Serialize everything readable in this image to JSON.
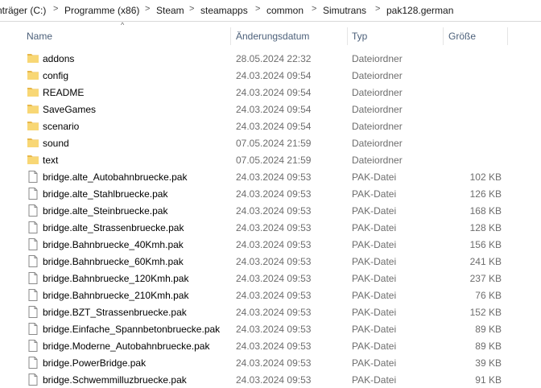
{
  "breadcrumb": {
    "items": [
      "nträger (C:)",
      "Programme (x86)",
      "Steam",
      "steamapps",
      "common",
      "Simutrans",
      "pak128.german"
    ],
    "separator": ">"
  },
  "columns": {
    "name": "Name",
    "date": "Änderungsdatum",
    "type": "Typ",
    "size": "Größe",
    "sort_indicator": "^"
  },
  "files": [
    {
      "kind": "folder",
      "name": "addons",
      "date": "28.05.2024 22:32",
      "type": "Dateiordner",
      "size": ""
    },
    {
      "kind": "folder",
      "name": "config",
      "date": "24.03.2024 09:54",
      "type": "Dateiordner",
      "size": ""
    },
    {
      "kind": "folder",
      "name": "README",
      "date": "24.03.2024 09:54",
      "type": "Dateiordner",
      "size": ""
    },
    {
      "kind": "folder",
      "name": "SaveGames",
      "date": "24.03.2024 09:54",
      "type": "Dateiordner",
      "size": ""
    },
    {
      "kind": "folder",
      "name": "scenario",
      "date": "24.03.2024 09:54",
      "type": "Dateiordner",
      "size": ""
    },
    {
      "kind": "folder",
      "name": "sound",
      "date": "07.05.2024 21:59",
      "type": "Dateiordner",
      "size": ""
    },
    {
      "kind": "folder",
      "name": "text",
      "date": "07.05.2024 21:59",
      "type": "Dateiordner",
      "size": ""
    },
    {
      "kind": "file",
      "name": "bridge.alte_Autobahnbruecke.pak",
      "date": "24.03.2024 09:53",
      "type": "PAK-Datei",
      "size": "102 KB"
    },
    {
      "kind": "file",
      "name": "bridge.alte_Stahlbruecke.pak",
      "date": "24.03.2024 09:53",
      "type": "PAK-Datei",
      "size": "126 KB"
    },
    {
      "kind": "file",
      "name": "bridge.alte_Steinbruecke.pak",
      "date": "24.03.2024 09:53",
      "type": "PAK-Datei",
      "size": "168 KB"
    },
    {
      "kind": "file",
      "name": "bridge.alte_Strassenbruecke.pak",
      "date": "24.03.2024 09:53",
      "type": "PAK-Datei",
      "size": "128 KB"
    },
    {
      "kind": "file",
      "name": "bridge.Bahnbruecke_40Kmh.pak",
      "date": "24.03.2024 09:53",
      "type": "PAK-Datei",
      "size": "156 KB"
    },
    {
      "kind": "file",
      "name": "bridge.Bahnbruecke_60Kmh.pak",
      "date": "24.03.2024 09:53",
      "type": "PAK-Datei",
      "size": "241 KB"
    },
    {
      "kind": "file",
      "name": "bridge.Bahnbruecke_120Kmh.pak",
      "date": "24.03.2024 09:53",
      "type": "PAK-Datei",
      "size": "237 KB"
    },
    {
      "kind": "file",
      "name": "bridge.Bahnbruecke_210Kmh.pak",
      "date": "24.03.2024 09:53",
      "type": "PAK-Datei",
      "size": "76 KB"
    },
    {
      "kind": "file",
      "name": "bridge.BZT_Strassenbruecke.pak",
      "date": "24.03.2024 09:53",
      "type": "PAK-Datei",
      "size": "152 KB"
    },
    {
      "kind": "file",
      "name": "bridge.Einfache_Spannbetonbruecke.pak",
      "date": "24.03.2024 09:53",
      "type": "PAK-Datei",
      "size": "89 KB"
    },
    {
      "kind": "file",
      "name": "bridge.Moderne_Autobahnbruecke.pak",
      "date": "24.03.2024 09:53",
      "type": "PAK-Datei",
      "size": "89 KB"
    },
    {
      "kind": "file",
      "name": "bridge.PowerBridge.pak",
      "date": "24.03.2024 09:53",
      "type": "PAK-Datei",
      "size": "39 KB"
    },
    {
      "kind": "file",
      "name": "bridge.Schwemmilluzbruecke.pak",
      "date": "24.03.2024 09:53",
      "type": "PAK-Datei",
      "size": "91 KB"
    }
  ],
  "colors": {
    "folder": "#f8d775",
    "folder_dark": "#e8b84a",
    "header_text": "#4c607a",
    "meta_text": "#6d6d6d"
  },
  "icons": {
    "folder": "folder-icon",
    "file": "file-icon"
  }
}
